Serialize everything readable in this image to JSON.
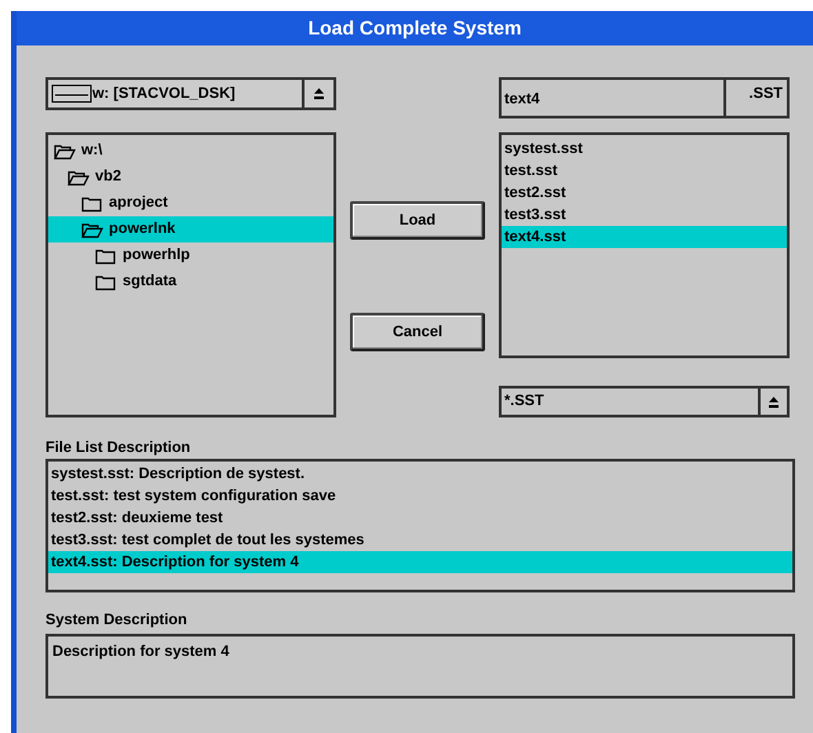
{
  "window": {
    "title": "Load Complete System"
  },
  "drive": {
    "value": "w: [STACVOL_DSK]"
  },
  "tree": [
    {
      "label": "w:\\",
      "open": true,
      "selected": false,
      "children": [
        {
          "label": "vb2",
          "open": true,
          "selected": false,
          "children": [
            {
              "label": "aproject",
              "open": false,
              "selected": false
            },
            {
              "label": "powerlnk",
              "open": true,
              "selected": true,
              "children": [
                {
                  "label": "powerhlp",
                  "open": false,
                  "selected": false
                },
                {
                  "label": "sgtdata",
                  "open": false,
                  "selected": false
                }
              ]
            }
          ]
        }
      ]
    }
  ],
  "buttons": [
    {
      "label": "Load"
    },
    {
      "label": "Cancel"
    }
  ],
  "filename": {
    "value": "text4",
    "extension": ".SST"
  },
  "files": [
    {
      "label": "systest.sst",
      "selected": false
    },
    {
      "label": "test.sst",
      "selected": false
    },
    {
      "label": "test2.sst",
      "selected": false
    },
    {
      "label": "test3.sst",
      "selected": false
    },
    {
      "label": "text4.sst",
      "selected": true
    }
  ],
  "filter": {
    "value": "*.SST"
  },
  "file_list_description": {
    "label": "File List Description",
    "items": [
      {
        "label": "systest.sst: Description de systest.",
        "selected": false
      },
      {
        "label": "test.sst: test system configuration save",
        "selected": false
      },
      {
        "label": "test2.sst: deuxieme test",
        "selected": false
      },
      {
        "label": "test3.sst: test complet de tout les systemes",
        "selected": false
      },
      {
        "label": "text4.sst: Description for system 4",
        "selected": true
      }
    ]
  },
  "system_description": {
    "label": "System Description",
    "value": "Description for system 4"
  }
}
